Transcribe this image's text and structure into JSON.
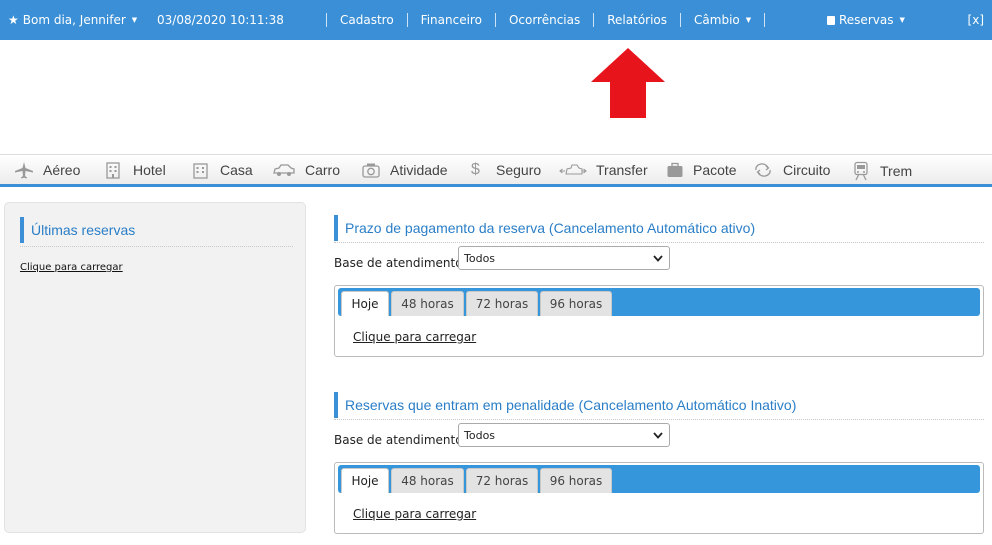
{
  "topbar": {
    "greeting": "Bom dia, Jennifer",
    "datetime": "03/08/2020 10:11:38",
    "menu": [
      "Cadastro",
      "Financeiro",
      "Ocorrências",
      "Relatórios",
      "Câmbio"
    ],
    "reservas": "Reservas",
    "close": "[x]"
  },
  "products": [
    {
      "label": "Aéreo",
      "icon": "airplane-icon"
    },
    {
      "label": "Hotel",
      "icon": "building-icon"
    },
    {
      "label": "Casa",
      "icon": "house-icon"
    },
    {
      "label": "Carro",
      "icon": "car-icon"
    },
    {
      "label": "Atividade",
      "icon": "camera-icon"
    },
    {
      "label": "Seguro",
      "icon": "dollar-icon"
    },
    {
      "label": "Transfer",
      "icon": "transfer-icon"
    },
    {
      "label": "Pacote",
      "icon": "suitcase-icon"
    },
    {
      "label": "Circuito",
      "icon": "loop-icon"
    },
    {
      "label": "Trem",
      "icon": "train-icon"
    }
  ],
  "sidebar": {
    "title": "Últimas reservas",
    "load": "Clique para carregar"
  },
  "section1": {
    "title": "Prazo de pagamento da reserva (Cancelamento Automático ativo)",
    "base_label": "Base de atendimento",
    "base_value": "Todos",
    "tabs": [
      "Hoje",
      "48 horas",
      "72 horas",
      "96 horas"
    ],
    "load": "Clique para carregar"
  },
  "section2": {
    "title": "Reservas que entram em penalidade (Cancelamento Automático Inativo)",
    "base_label": "Base de atendimento",
    "base_value": "Todos",
    "tabs": [
      "Hoje",
      "48 horas",
      "72 horas",
      "96 horas"
    ],
    "load": "Clique para carregar"
  },
  "colors": {
    "topbar": "#3a8fd6",
    "accent": "#2a7ec7",
    "tabstrip": "#3596db",
    "arrow": "#e8141c"
  }
}
